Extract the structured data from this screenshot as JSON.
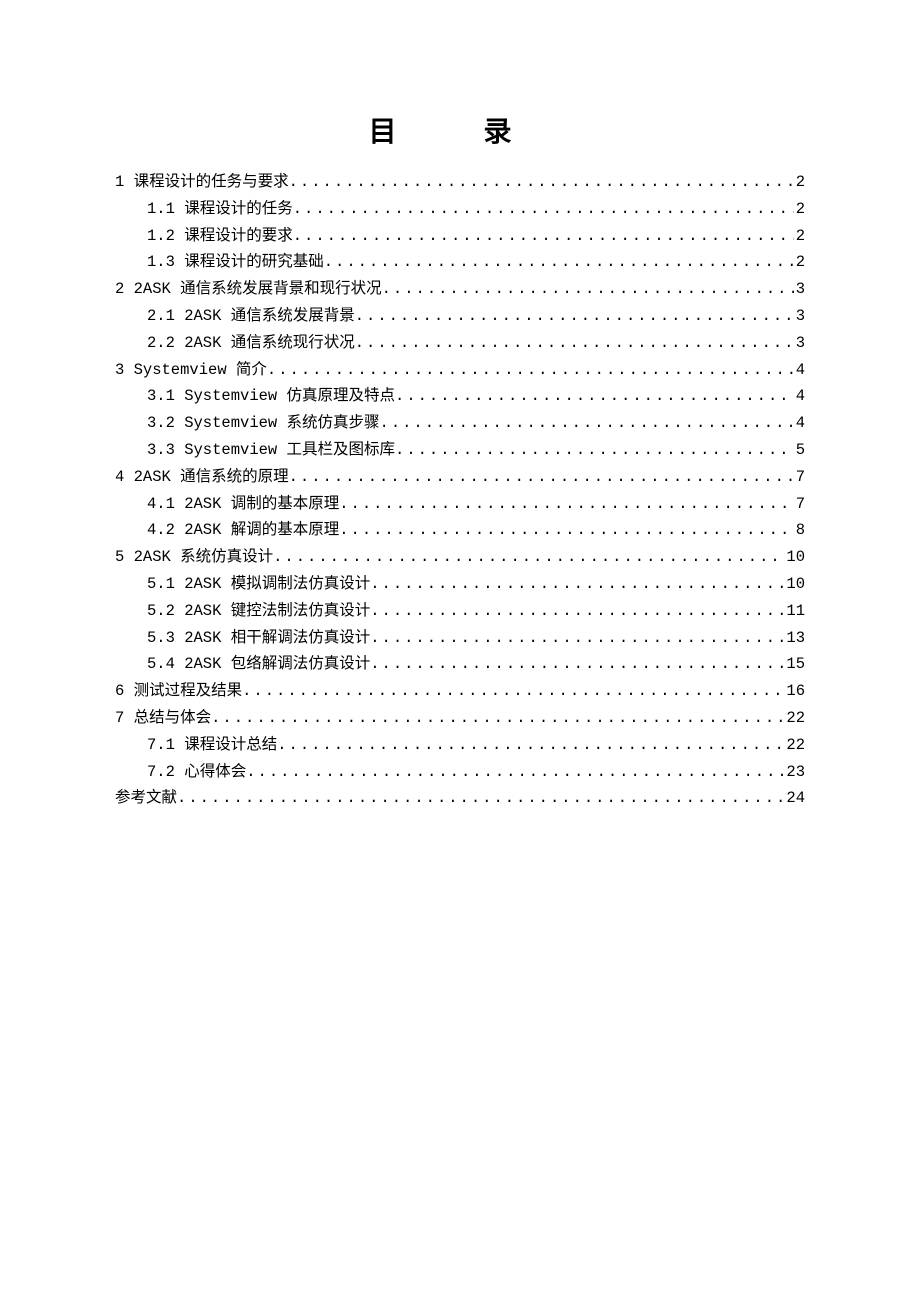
{
  "title": "目  录",
  "entries": [
    {
      "level": 1,
      "label": "1 课程设计的任务与要求",
      "page": "2"
    },
    {
      "level": 2,
      "label": "1.1 课程设计的任务 ",
      "page": "2"
    },
    {
      "level": 2,
      "label": "1.2 课程设计的要求 ",
      "page": "2"
    },
    {
      "level": 2,
      "label": "1.3 课程设计的研究基础 ",
      "page": "2"
    },
    {
      "level": 1,
      "label": "2 2ASK 通信系统发展背景和现行状况 ",
      "page": "3"
    },
    {
      "level": 2,
      "label": "2.1 2ASK 通信系统发展背景",
      "page": "3"
    },
    {
      "level": 2,
      "label": "2.2 2ASK 通信系统现行状况",
      "page": "3"
    },
    {
      "level": 1,
      "label": "3 Systemview 简介 ",
      "page": "4"
    },
    {
      "level": 2,
      "label": "3.1 Systemview 仿真原理及特点",
      "page": "4"
    },
    {
      "level": 2,
      "label": "3.2 Systemview 系统仿真步骤",
      "page": "4"
    },
    {
      "level": 2,
      "label": "3.3 Systemview 工具栏及图标库",
      "page": "5"
    },
    {
      "level": 1,
      "label": "4 2ASK 通信系统的原理",
      "page": "7"
    },
    {
      "level": 2,
      "label": "4.1 2ASK 调制的基本原理",
      "page": "7"
    },
    {
      "level": 2,
      "label": "4.2 2ASK 解调的基本原理",
      "page": "8"
    },
    {
      "level": 1,
      "label": "5 2ASK 系统仿真设计 ",
      "page": "10"
    },
    {
      "level": 2,
      "label": "5.1 2ASK 模拟调制法仿真设计",
      "page": "10"
    },
    {
      "level": 2,
      "label": "5.2 2ASK 键控法制法仿真设计",
      "page": "11"
    },
    {
      "level": 2,
      "label": "5.3 2ASK 相干解调法仿真设计",
      "page": "13"
    },
    {
      "level": 2,
      "label": "5.4 2ASK 包络解调法仿真设计",
      "page": "15"
    },
    {
      "level": 1,
      "label": "6 测试过程及结果",
      "page": "16"
    },
    {
      "level": 1,
      "label": "7 总结与体会 ",
      "page": "22"
    },
    {
      "level": 2,
      "label": "7.1 课程设计总结",
      "page": "22"
    },
    {
      "level": 2,
      "label": "7.2 心得体会 ",
      "page": "23"
    },
    {
      "level": 1,
      "label": "参考文献",
      "page": "24"
    }
  ]
}
